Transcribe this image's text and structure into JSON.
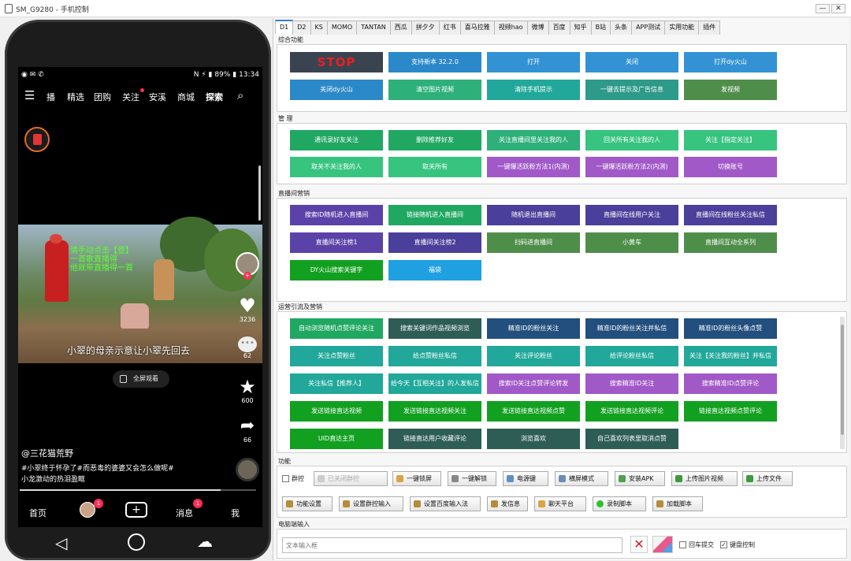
{
  "window": {
    "title": "SM_G9280 - 手机控制"
  },
  "phone": {
    "status_time": "13:34",
    "battery": "89%",
    "nav_tabs": [
      "播",
      "精选",
      "团购",
      "关注",
      "安溪",
      "商城",
      "探索"
    ],
    "video_caption_top": "请手动点击【登】\n一首歌直播得\n他就带直播得一首",
    "video_caption": "小翠的母亲示意让小翠先回去",
    "fullscreen_label": "全屏观看",
    "likes": "3236",
    "comments": "62",
    "favorites": "600",
    "shares": "66",
    "author": "@三花猫荒野",
    "desc_line1": "#小翠终于怀孕了#而恶毒的婆婆又会怎么做呢#",
    "desc_line2": "小龙激动的热泪盈眶",
    "bottom_tabs": [
      "首页",
      "消息",
      "我"
    ],
    "badge_count": "1",
    "message_badge": "1"
  },
  "tabs": [
    "D1",
    "D2",
    "KS",
    "MOMO",
    "TANTAN",
    "西瓜",
    "拼夕夕",
    "红书",
    "喜马拉雅",
    "视频hao",
    "微博",
    "百度",
    "知乎",
    "B站",
    "头条",
    "APP测试",
    "实用功能",
    "插件"
  ],
  "sections": {
    "general": {
      "title": "综合功能",
      "buttons": [
        "STOP",
        "支持新本 32.2.0",
        "打开",
        "关闭",
        "打开dy火山",
        "关闭dy火山",
        "清空图片视频",
        "清除手机提示",
        "一键去提示及广告信息",
        "发视频"
      ]
    },
    "manage": {
      "title": "管 理",
      "buttons": [
        "通讯录好友关注",
        "删除推荐好友",
        "关注直播间里关注我的人",
        "回关所有关注我的人",
        "关注【指定关注】",
        "取关不关注我的人",
        "取关所有",
        "一键爆活跃粉方法1(内测)",
        "一键爆活跃粉方法2(内测)",
        "切换账号"
      ]
    },
    "live": {
      "title": "直播间营销",
      "buttons": [
        "搜索ID随机进入直播间",
        "链接随机进入直播间",
        "随机退出直播间",
        "直播间在线用户关注",
        "直播间在线粉丝关注私信",
        "直播间关注榜1",
        "直播间关注榜2",
        "扫码进直播间",
        "小黄车",
        "直播间互动全系列",
        "DY火山搜索关键字",
        "福袋"
      ]
    },
    "traffic": {
      "title": "运营引流及营销",
      "buttons": [
        "自动浏览随机点赞评论关注",
        "搜索关键词作品视频浏览",
        "精准ID的粉丝关注",
        "精准ID的粉丝关注并私信",
        "精准ID的粉丝头像点赞",
        "关注点赞粉丝",
        "给点赞粉丝私信",
        "关注评论粉丝",
        "给评论粉丝私信",
        "关注【关注我的粉丝】并私信",
        "关注私信【推荐人】",
        "给今天【互相关注】的人发私信",
        "搜索ID关注点赞评论转发",
        "搜索精准ID关注",
        "搜索精准ID点赞评论",
        "发送链接直达视频",
        "发送链接直达视频关注",
        "发送链接直达视频点赞",
        "发送链接直达视频评论",
        "链接直达视频点赞评论",
        "UID直达主页",
        "链接直达用户收藏评论",
        "浏览喜欢",
        "自己喜欢列表里取消点赞"
      ]
    }
  },
  "functions": {
    "title": "功能",
    "group_control_label": "群控",
    "group_status": "已关闭群控",
    "row1": [
      "一键锁屏",
      "一键解锁",
      "电源键",
      "横屏模式",
      "安装APK",
      "上传图片视频",
      "上传文件"
    ],
    "row2": [
      "功能设置",
      "设置群控输入",
      "设置百度输入法",
      "发信息",
      "聊天平台",
      "录制脚本",
      "加载脚本"
    ]
  },
  "pc_input": {
    "title": "电脑端输入",
    "placeholder": "文本输入框",
    "enter_label": "回车提交",
    "keyboard_label": "键盘控制"
  }
}
